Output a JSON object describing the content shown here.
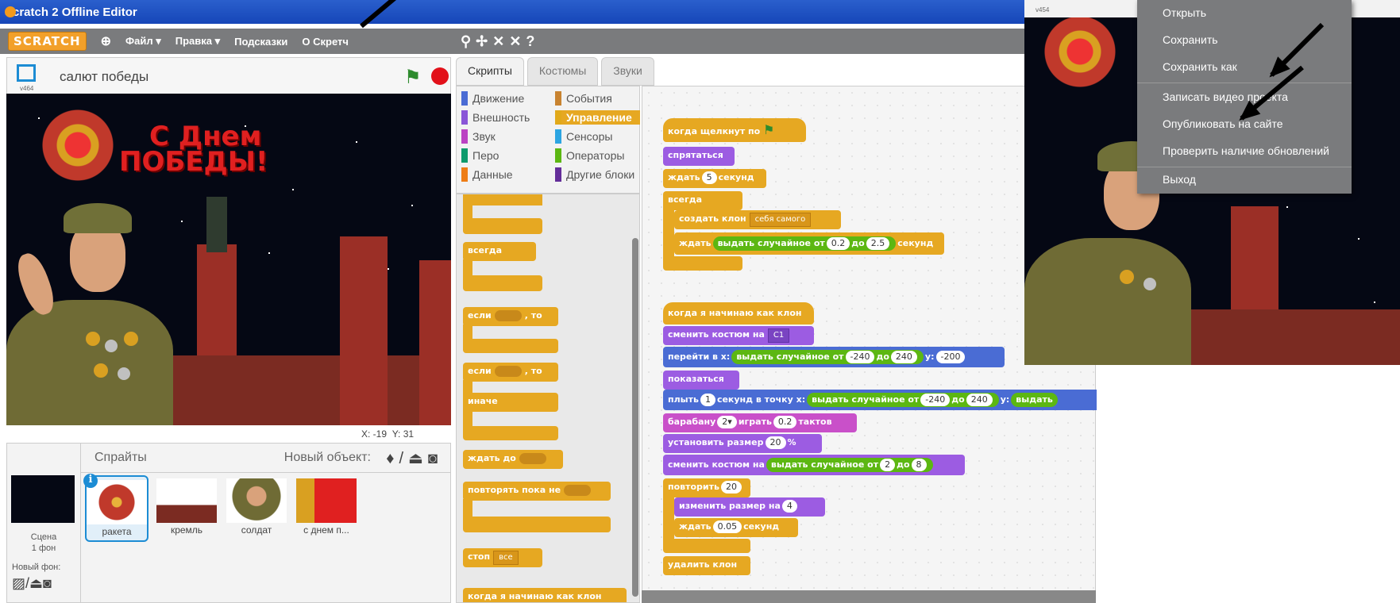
{
  "window": {
    "title": "Scratch 2 Offline Editor"
  },
  "menubar": {
    "logo": "SCRATCH",
    "file": "Файл ▾",
    "edit": "Правка ▾",
    "tips": "Подсказки",
    "about": "О Скретч"
  },
  "stage": {
    "version": "v464",
    "project_title": "салют победы",
    "banner_line1": "С Днем",
    "banner_line2": "ПОБЕДЫ!",
    "mouse_x": "X: -19",
    "mouse_y": "Y: 31"
  },
  "sprites": {
    "header": "Спрайты",
    "new_sprite": "Новый объект:",
    "scene_label": "Сцена",
    "scene_backdrops": "1 фон",
    "new_backdrop": "Новый фон:",
    "items": [
      {
        "name": "ракета"
      },
      {
        "name": "кремль"
      },
      {
        "name": "солдат"
      },
      {
        "name": "с днем п..."
      }
    ]
  },
  "tabs": {
    "scripts": "Скрипты",
    "costumes": "Костюмы",
    "sounds": "Звуки"
  },
  "categories": [
    {
      "label": "Движение",
      "color": "#4a6cd4"
    },
    {
      "label": "События",
      "color": "#c88330"
    },
    {
      "label": "Внешность",
      "color": "#8a55d7"
    },
    {
      "label": "Управление",
      "color": "#e1a91a"
    },
    {
      "label": "Звук",
      "color": "#bb42c3"
    },
    {
      "label": "Сенсоры",
      "color": "#2ca5e2"
    },
    {
      "label": "Перо",
      "color": "#0e9a6c"
    },
    {
      "label": "Операторы",
      "color": "#5cb712"
    },
    {
      "label": "Данные",
      "color": "#ee7d16"
    },
    {
      "label": "Другие блоки",
      "color": "#632d99"
    }
  ],
  "palette": {
    "forever": "всегда",
    "if": "если",
    "then": ", то",
    "if2": "если",
    "then2": ", то",
    "else": "иначе",
    "wait_until": "ждать до",
    "repeat_until": "повторять пока не",
    "stop": "стоп",
    "stop_opt": "все",
    "when_clone": "когда я начинаю как клон",
    "create_clone": "создать клон",
    "create_clone_opt": "себя самого"
  },
  "script1": {
    "hat": "когда щелкнут по",
    "hide": "спрятаться",
    "wait": "ждать",
    "wait_n": "5",
    "wait_unit": "секунд",
    "forever": "всегда",
    "create_clone": "создать клон",
    "clone_opt": "себя самого",
    "wait2": "ждать",
    "random": "выдать случайное от",
    "r_from": "0.2",
    "r_to_label": "до",
    "r_to": "2.5",
    "sec": "секунд"
  },
  "script2": {
    "hat": "когда я начинаю как клон",
    "costume": "сменить костюм на",
    "costume_opt": "C1",
    "goto": "перейти в x:",
    "goto_rand": "выдать случайное от",
    "goto_from": "-240",
    "to1": "до",
    "goto_to": "240",
    "goto_y": "y:",
    "goto_yval": "-200",
    "show": "показаться",
    "glide": "плыть",
    "glide_n": "1",
    "glide_txt": "секунд в точку x:",
    "glide_rand": "выдать случайное от",
    "glide_from": "-240",
    "to2": "до",
    "glide_to": "240",
    "glide_y": "y:",
    "glide_rand2": "выдать",
    "drum": "барабану",
    "drum_n": "2▾",
    "drum_play": "играть",
    "drum_beats": "0.2",
    "drum_unit": "тактов",
    "size": "установить размер",
    "size_n": "20",
    "size_unit": "%",
    "costume2": "сменить костюм на",
    "costume2_rand": "выдать случайное от",
    "c2_from": "2",
    "to3": "до",
    "c2_to": "8",
    "repeat": "повторить",
    "repeat_n": "20",
    "change_size": "изменить размер на",
    "change_n": "4",
    "wait3": "ждать",
    "wait3_n": "0.05",
    "wait3_unit": "секунд",
    "delete": "удалить клон"
  },
  "right": {
    "version": "v454",
    "menu_items": [
      "Открыть",
      "Сохранить",
      "Сохранить как",
      "Записать видео проекта",
      "Опубликовать на сайте",
      "Проверить наличие обновлений",
      "Выход"
    ]
  }
}
